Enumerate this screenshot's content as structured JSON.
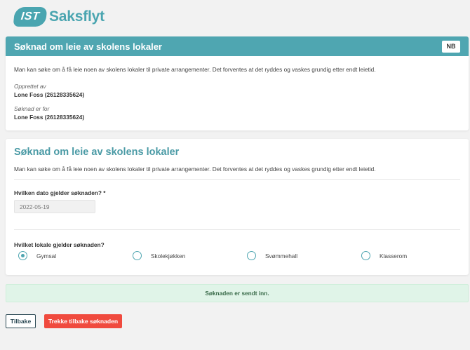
{
  "logo": {
    "badge": "IST",
    "text": "Saksflyt"
  },
  "info_card": {
    "title": "Søknad om leie av skolens lokaler",
    "language_button": "NB",
    "intro": "Man kan søke om å få leie noen av skolens lokaler til private arrangementer. Det forventes at det ryddes og vaskes grundig etter endt leietid.",
    "created_by_label": "Opprettet av",
    "created_by_value": "Lone Foss (26128335624)",
    "applicant_label": "Søknad er for",
    "applicant_value": "Lone Foss (26128335624)"
  },
  "form_card": {
    "title": "Søknad om leie av skolens lokaler",
    "intro": "Man kan søke om å få leie noen av skolens lokaler til private arrangementer. Det forventes at det ryddes og vaskes grundig etter endt leietid.",
    "date_question": "Hvilken dato gjelder søknaden? *",
    "date_value": "2022-05-19",
    "room_question": "Hvilket lokale gjelder søknaden?",
    "room_options": [
      "Gymsal",
      "Skolekjøkken",
      "Svømmehall",
      "Klasserom"
    ],
    "selected_room": "Gymsal"
  },
  "success_message": "Søknaden er sendt inn.",
  "buttons": {
    "back": "Tilbake",
    "withdraw": "Trekke tilbake søknaden"
  },
  "colors": {
    "accent": "#4fa6b1",
    "danger": "#f04a3e",
    "success_bg": "#e0f4e8"
  }
}
